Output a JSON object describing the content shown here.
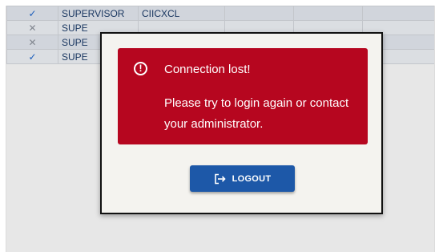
{
  "grid": {
    "rows": [
      {
        "status_icon": "check-icon",
        "status_glyph": "✓",
        "role": "SUPERVISOR",
        "code": "CIICXCL"
      },
      {
        "status_icon": "x-icon",
        "status_glyph": "✕",
        "role": "SUPE",
        "code": ""
      },
      {
        "status_icon": "x-icon",
        "status_glyph": "✕",
        "role": "SUPE",
        "code": ""
      },
      {
        "status_icon": "check-icon",
        "status_glyph": "✓",
        "role": "SUPE",
        "code": ""
      }
    ]
  },
  "dialog": {
    "error": {
      "icon": "alert-circle-icon",
      "icon_glyph": "!",
      "title": "Connection lost!",
      "message": "Please try to login again or contact your administrator.",
      "color": "#b6061f"
    },
    "logout_button": {
      "icon": "logout-icon",
      "label": "LOGOUT",
      "color": "#1d58a8"
    }
  }
}
